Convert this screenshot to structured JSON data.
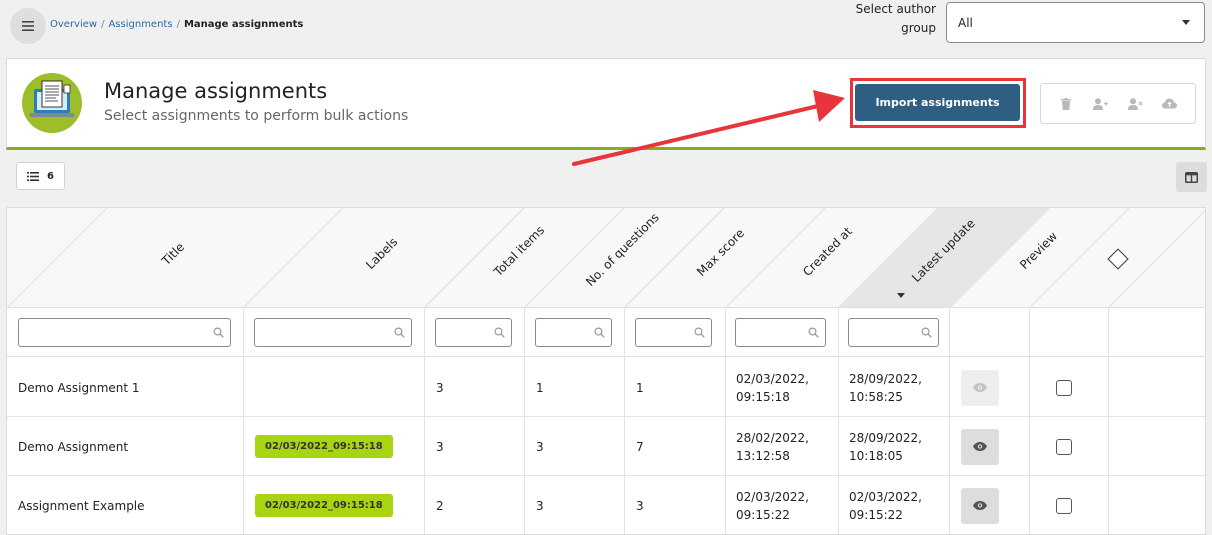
{
  "breadcrumb": {
    "items": [
      "Overview",
      "Assignments"
    ],
    "separator": "/",
    "current": "Manage assignments"
  },
  "author_group": {
    "label_line1": "Select author",
    "label_line2": "group",
    "value": "All"
  },
  "header": {
    "title": "Manage assignments",
    "subtitle": "Select assignments to perform bulk actions",
    "import_button": "Import assignments"
  },
  "toolbar": {
    "list_count": "6"
  },
  "table": {
    "columns": [
      "Title",
      "Labels",
      "Total items",
      "No. of questions",
      "Max score",
      "Created at",
      "Latest update",
      "Preview"
    ],
    "rows": [
      {
        "title": "Demo Assignment 1",
        "label": "",
        "total_items": "3",
        "questions": "1",
        "max_score": "1",
        "created_date": "02/03/2022,",
        "created_time": "09:15:18",
        "updated_date": "28/09/2022,",
        "updated_time": "10:58:25"
      },
      {
        "title": "Demo Assignment",
        "label": "02/03/2022_09:15:18",
        "total_items": "3",
        "questions": "3",
        "max_score": "7",
        "created_date": "28/02/2022,",
        "created_time": "13:12:58",
        "updated_date": "28/09/2022,",
        "updated_time": "10:18:05"
      },
      {
        "title": "Assignment Example",
        "label": "02/03/2022_09:15:18",
        "total_items": "2",
        "questions": "3",
        "max_score": "3",
        "created_date": "02/03/2022,",
        "created_time": "09:15:22",
        "updated_date": "02/03/2022,",
        "updated_time": "09:15:22"
      }
    ]
  },
  "colors": {
    "accent_green": "#8aac1c",
    "import_button": "#2f5e83",
    "highlight_red": "#e8353b",
    "label_badge": "#a9d411",
    "link": "#2d6aa6"
  }
}
